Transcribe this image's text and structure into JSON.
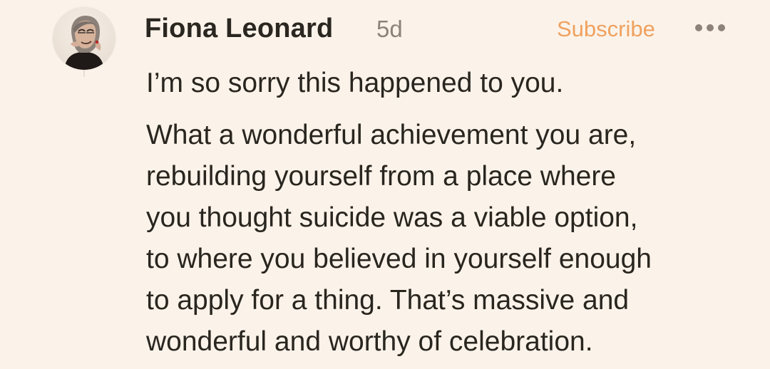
{
  "comment": {
    "author": "Fiona Leonard",
    "timestamp": "5d",
    "subscribe_label": "Subscribe",
    "more_icon": "more-horizontal-icon",
    "avatar_icon": "profile-photo",
    "body": {
      "paragraph_1": "I’m so sorry this happened to you.",
      "paragraph_2_lines": [
        "What a wonderful achievement you are,",
        "rebuilding yourself from a place where",
        "you thought suicide was a viable option,",
        "to where you believed in yourself enough",
        "to apply for a thing. That’s massive and",
        "wonderful and worthy of celebration."
      ]
    }
  },
  "colors": {
    "background": "#fbf3ea",
    "text": "#29251f",
    "muted": "#8c8378",
    "accent": "#f0a15f"
  }
}
